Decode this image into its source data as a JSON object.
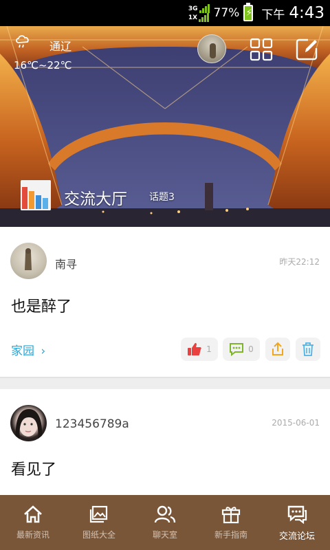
{
  "status_bar": {
    "network_top": "3G",
    "network_bottom": "1X",
    "battery_percent": "77%",
    "ampm": "下午",
    "time": "4:43"
  },
  "header": {
    "weather": {
      "condition": "通辽",
      "temperature": "16℃~22℃",
      "icon": "cloud-rain-icon"
    },
    "forum_title": "交流大厅",
    "topic_count": "话题3",
    "icons": [
      "grid-icon",
      "edit-icon"
    ]
  },
  "posts": [
    {
      "username": "南寻",
      "timestamp": "昨天22:12",
      "content": "也是醉了",
      "category": "家园",
      "like_count": "1",
      "comment_count": "0"
    },
    {
      "username": "123456789a",
      "timestamp": "2015-06-01",
      "content": "看见了"
    }
  ],
  "bottom_nav": {
    "items": [
      {
        "label": "最新资讯",
        "icon": "home-icon"
      },
      {
        "label": "图纸大全",
        "icon": "image-icon"
      },
      {
        "label": "聊天室",
        "icon": "users-icon"
      },
      {
        "label": "新手指南",
        "icon": "gift-box-icon"
      },
      {
        "label": "交流论坛",
        "icon": "chat-bubble-icon"
      }
    ],
    "active_index": 4
  },
  "colors": {
    "accent_link": "#26a7d8",
    "nav_background": "#7a5639",
    "battery_green": "#7fc31c",
    "like_red": "#e8413f",
    "comment_green": "#7fb52a",
    "share_orange": "#f2a51d",
    "delete_blue": "#4fb3e6"
  }
}
